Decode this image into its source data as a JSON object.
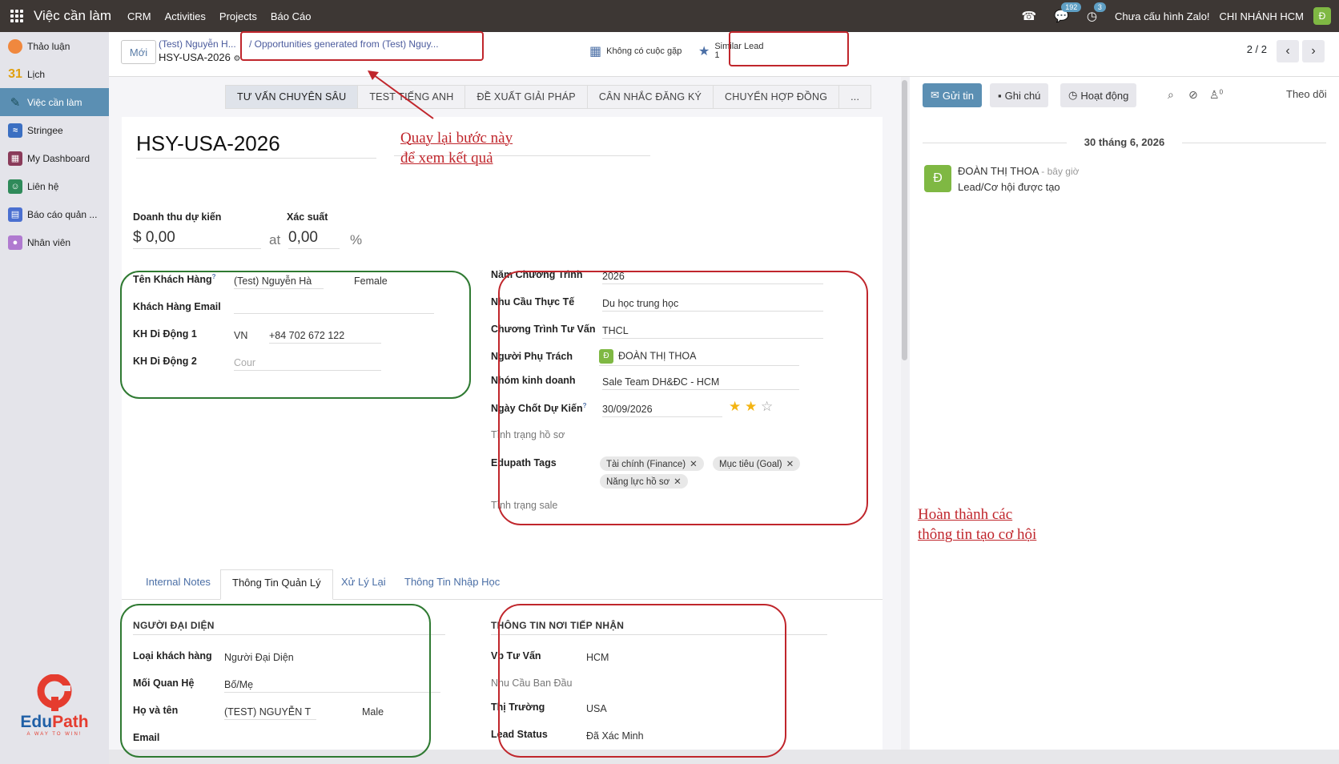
{
  "topbar": {
    "app_name": "Việc cần làm",
    "menu": [
      "CRM",
      "Activities",
      "Projects",
      "Báo Cáo"
    ],
    "messages_count": "192",
    "activities_count": "3",
    "zalo_status": "Chưa cấu hình Zalo!",
    "branch": "CHI NHÁNH HCM",
    "user_initial": "Đ"
  },
  "sidebar": {
    "items": [
      {
        "label": "Thảo luận",
        "icon": "discuss-icon",
        "color": "#f0883e"
      },
      {
        "label": "Lịch",
        "icon": "calendar-icon",
        "color": "#f0c420"
      },
      {
        "label": "Việc cần làm",
        "icon": "todo-icon",
        "color": "#2f7a8a"
      },
      {
        "label": "Stringee",
        "icon": "stringee-icon",
        "color": "#3b6fc2"
      },
      {
        "label": "My Dashboard",
        "icon": "dashboard-icon",
        "color": "#8a3b5a"
      },
      {
        "label": "Liên hệ",
        "icon": "contacts-icon",
        "color": "#2f8a5a"
      },
      {
        "label": "Báo cáo quản ...",
        "icon": "report-icon",
        "color": "#4a6fd0"
      },
      {
        "label": "Nhân viên",
        "icon": "employees-icon",
        "color": "#b07ad0"
      }
    ],
    "logo_text_a": "Edu",
    "logo_text_b": "Path",
    "logo_tagline": "A WAY TO WIN!"
  },
  "control": {
    "new_label": "Mới",
    "breadcrumb_parent": "(Test) Nguyễn H...",
    "breadcrumb_record": "HSY-USA-2026",
    "breadcrumb_link": "/  Opportunities generated from (Test) Nguy...",
    "meeting_label": "Không có cuộc gặp",
    "similar_label": "Similar Lead",
    "similar_count": "1",
    "pager": "2 / 2"
  },
  "stages": [
    "TƯ VẤN CHUYÊN SÂU",
    "TEST TIẾNG ANH",
    "ĐỀ XUẤT GIẢI PHÁP",
    "CÂN NHẮC ĐĂNG KÝ",
    "CHUYỂN HỢP ĐỒNG",
    "..."
  ],
  "form": {
    "title": "HSY-USA-2026",
    "revenue_label": "Doanh thu dự kiến",
    "revenue_value": "$ 0,00",
    "at_label": "at",
    "probability_label": "Xác suất",
    "probability_value": "0,00",
    "percent": "%",
    "customer_name_label": "Tên Khách Hàng",
    "customer_name": "(Test) Nguyễn Hà",
    "gender": "Female",
    "email_label": "Khách Hàng Email",
    "mobile1_label": "KH Di Động 1",
    "mobile1_country": "VN",
    "mobile1_value": "+84 702 672 122",
    "mobile2_label": "KH Di Động 2",
    "mobile2_placeholder": "Cour",
    "program_year_label": "Năm Chương Trình",
    "program_year": "2026",
    "need_label": "Nhu Cầu Thực Tế",
    "need": "Du học trung học",
    "program_label": "Chương Trình Tư Vấn",
    "program": "THCL",
    "owner_label": "Người Phụ Trách",
    "owner_initial": "Đ",
    "owner": "ĐOÀN THỊ THOA",
    "sales_team_label": "Nhóm kinh doanh",
    "sales_team": "Sale Team DH&ĐC - HCM",
    "close_date_label": "Ngày Chốt Dự Kiến",
    "close_date": "30/09/2026",
    "priority_stars": 2,
    "profile_status_label": "Tình trạng hồ sơ",
    "tags_label": "Edupath Tags",
    "tags": [
      "Tài chính (Finance)",
      "Mục tiêu (Goal)",
      "Năng lực hồ sơ"
    ],
    "sale_status_label": "Tình trạng sale"
  },
  "tabs": [
    "Internal Notes",
    "Thông Tin Quản Lý",
    "Xử Lý Lại",
    "Thông Tin Nhập Học"
  ],
  "representative": {
    "heading": "NGƯỜI ĐẠI DIỆN",
    "customer_type_label": "Loại khách hàng",
    "customer_type": "Người Đại Diện",
    "relation_label": "Mối Quan Hệ",
    "relation": "Bố/Mẹ",
    "fullname_label": "Họ và tên",
    "fullname": "(TEST) NGUYỄN T",
    "gender": "Male",
    "email_label": "Email"
  },
  "reception": {
    "heading": "THÔNG TIN NƠI TIẾP NHẬN",
    "office_label": "Vp Tư Vấn",
    "office": "HCM",
    "initial_need_label": "Nhu Cầu Ban Đầu",
    "market_label": "Thị Trường",
    "market": "USA",
    "lead_status_label": "Lead Status",
    "lead_status": "Đã Xác Minh"
  },
  "chatter": {
    "send_label": "Gửi tin",
    "note_label": "Ghi chú",
    "activity_label": "Hoạt động",
    "follower_count": "0",
    "follow_label": "Theo dõi",
    "date": "30 tháng 6, 2026",
    "author": "ĐOÀN THỊ THOA",
    "time": "- bây giờ",
    "message": "Lead/Cơ hội được tạo",
    "author_initial": "Đ"
  },
  "annotations": {
    "back_note_line1": "Quay lại bước này",
    "back_note_line2": "để xem kết quả",
    "complete_note_line1": "Hoàn thành các",
    "complete_note_line2": "thông tin tạo cơ hội"
  }
}
